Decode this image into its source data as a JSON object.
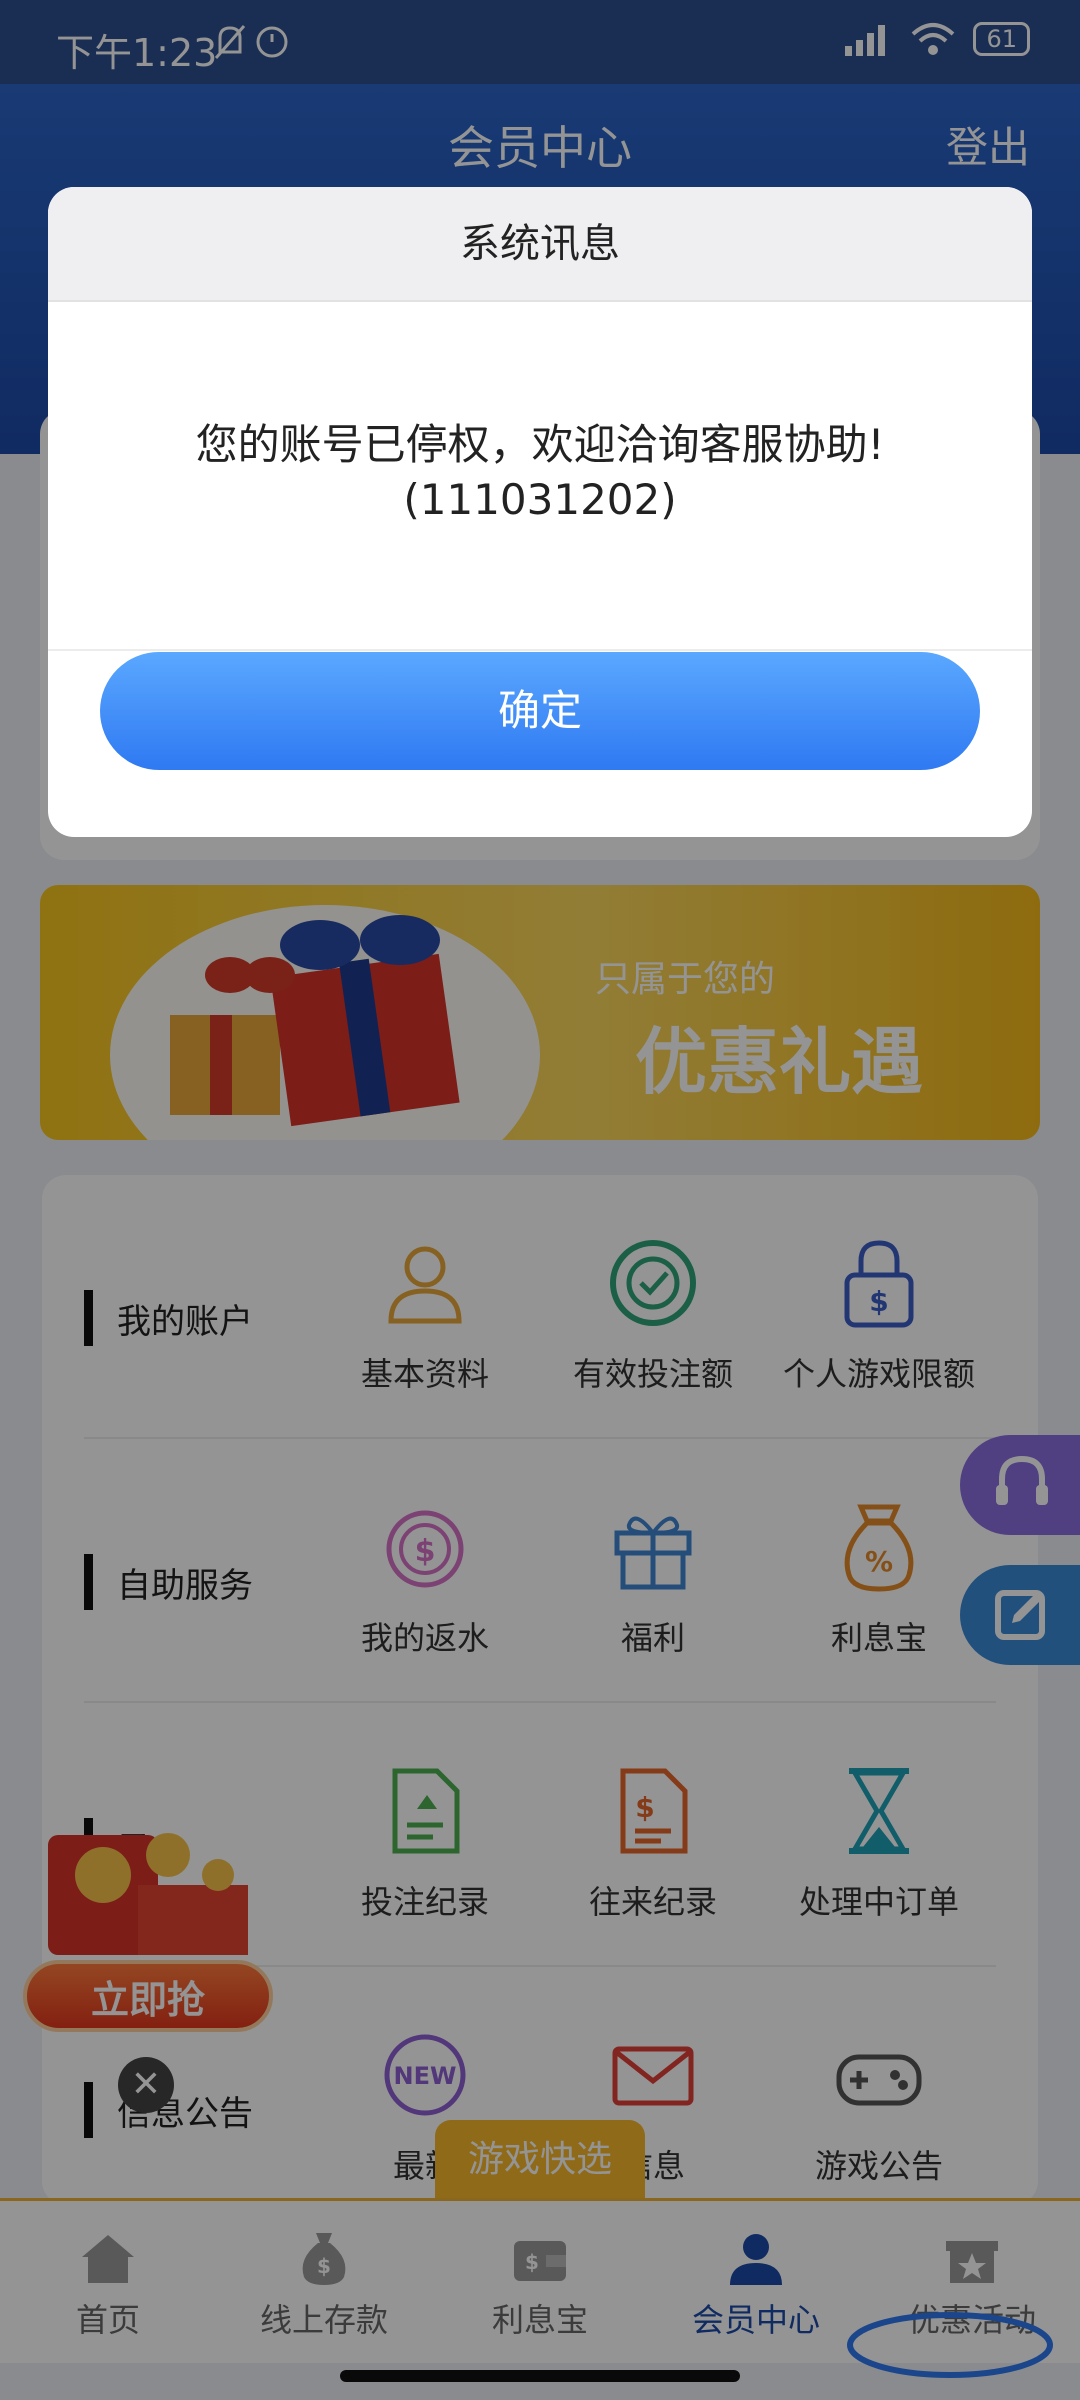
{
  "status_bar": {
    "time": "下午1:23",
    "battery": "61"
  },
  "header": {
    "title": "会员中心",
    "logout": "登出"
  },
  "banner": {
    "subtitle": "只属于您的",
    "title": "优惠礼遇"
  },
  "menu": {
    "rows": [
      {
        "label": "我的账户",
        "items": [
          {
            "label": "基本资料",
            "icon": "user-icon"
          },
          {
            "label": "有效投注额",
            "icon": "chip-icon"
          },
          {
            "label": "个人游戏限额",
            "icon": "lock-dollar-icon"
          }
        ]
      },
      {
        "label": "自助服务",
        "items": [
          {
            "label": "我的返水",
            "icon": "rebate-icon"
          },
          {
            "label": "福利",
            "icon": "gift-icon"
          },
          {
            "label": "利息宝",
            "icon": "money-bag-icon"
          }
        ]
      },
      {
        "label": "录",
        "items": [
          {
            "label": "投注纪录",
            "icon": "bet-record-icon"
          },
          {
            "label": "往来纪录",
            "icon": "transaction-record-icon"
          },
          {
            "label": "处理中订单",
            "icon": "hourglass-icon"
          }
        ]
      },
      {
        "label": "信息公告",
        "items": [
          {
            "label": "最新",
            "icon": "new-badge-icon"
          },
          {
            "label": "信息",
            "icon": "mail-icon"
          },
          {
            "label": "游戏公告",
            "icon": "gamepad-icon"
          }
        ]
      }
    ]
  },
  "floating": {
    "grab_button": "立即抢",
    "close": "✕",
    "quick_pick": "游戏快选"
  },
  "tabbar": [
    {
      "label": "首页",
      "icon": "home-icon"
    },
    {
      "label": "线上存款",
      "icon": "deposit-icon"
    },
    {
      "label": "利息宝",
      "icon": "wallet-icon"
    },
    {
      "label": "会员中心",
      "icon": "member-icon",
      "active": true
    },
    {
      "label": "优惠活动",
      "icon": "promo-icon"
    }
  ],
  "dialog": {
    "title": "系统讯息",
    "message_line1": "您的账号已停权，欢迎洽询客服协助!",
    "message_line2": "(111031202)",
    "confirm": "确定"
  },
  "colors": {
    "primary": "#2f79f2",
    "header": "#1d4aa8",
    "banner": "#f7c51e"
  }
}
